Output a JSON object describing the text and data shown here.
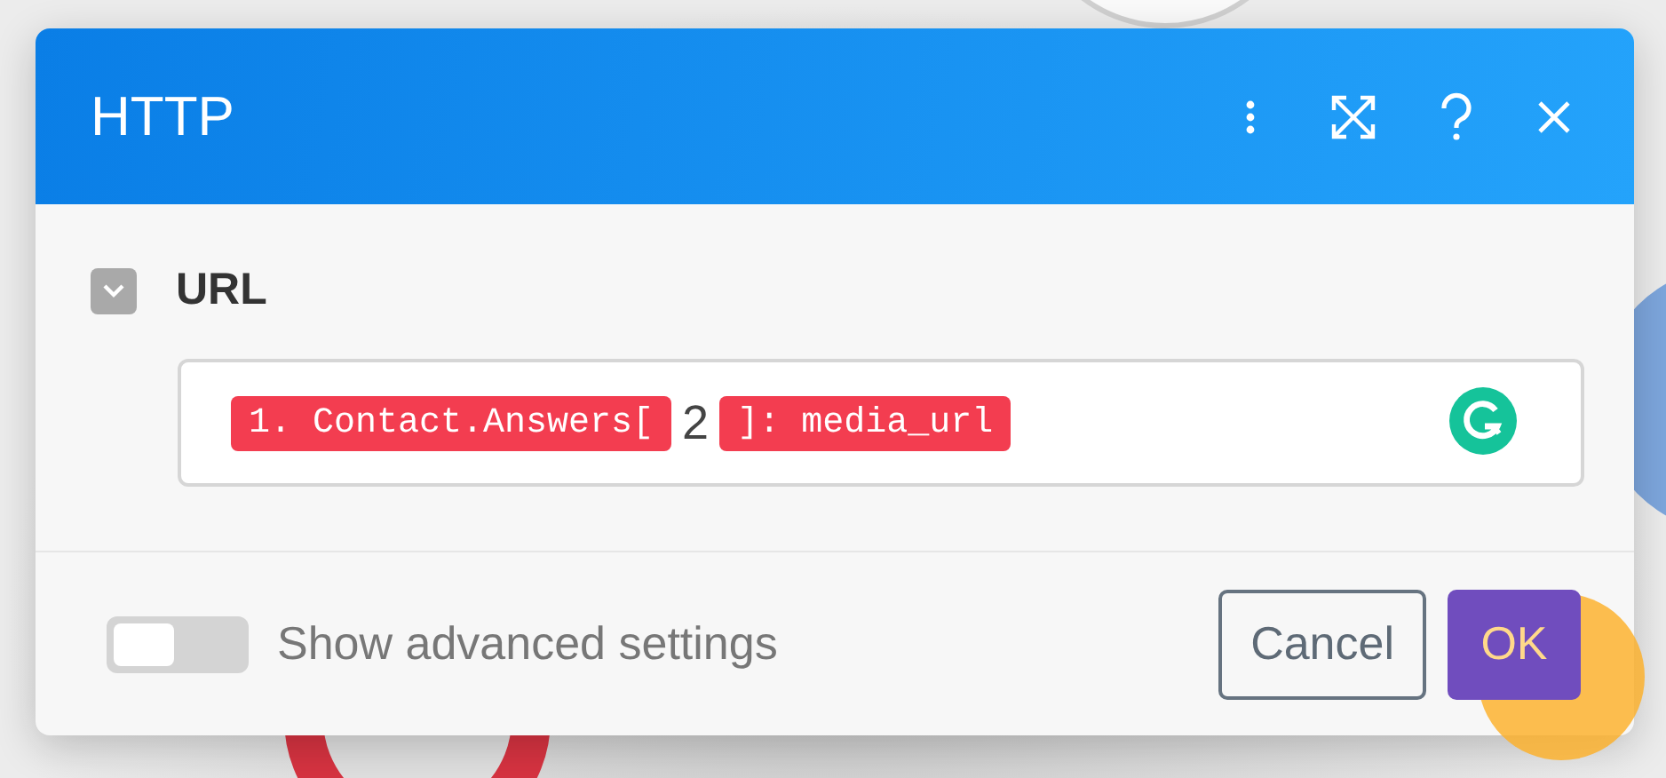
{
  "window": {
    "title": "HTTP"
  },
  "section": {
    "label": "URL",
    "expanded": true
  },
  "url_field": {
    "tokens": [
      {
        "kind": "pill",
        "text": "1. Contact.Answers["
      },
      {
        "kind": "plain",
        "text": "2"
      },
      {
        "kind": "pill",
        "text": "]: media_url"
      }
    ]
  },
  "advanced_toggle": {
    "label": "Show advanced settings",
    "on": false
  },
  "buttons": [
    {
      "label": "Cancel",
      "kind": "secondary"
    },
    {
      "label": "OK",
      "kind": "primary"
    }
  ]
}
